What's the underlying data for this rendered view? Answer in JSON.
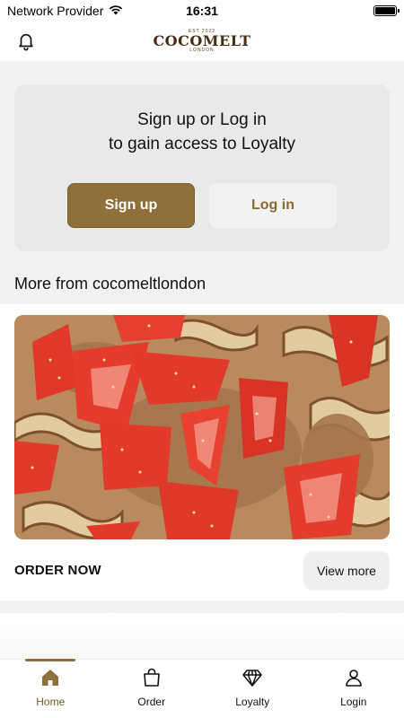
{
  "status_bar": {
    "carrier": "Network Provider",
    "time": "16:31"
  },
  "header": {
    "logo": {
      "est": "EST 2022",
      "name": "COCOMELT",
      "city": "LONDON"
    },
    "bell_icon": "bell-icon"
  },
  "login_card": {
    "line1": "Sign up or Log in",
    "line2": "to gain access to Loyalty",
    "signup_label": "Sign up",
    "login_label": "Log in"
  },
  "feed": {
    "section_title": "More from cocomeltlondon",
    "post": {
      "image_desc": "strawberries-on-chocolate-crepes",
      "cta_label": "ORDER NOW",
      "view_more_label": "View more"
    }
  },
  "tabs": [
    {
      "label": "Home",
      "icon": "home-icon",
      "active": true
    },
    {
      "label": "Order",
      "icon": "bag-icon",
      "active": false
    },
    {
      "label": "Loyalty",
      "icon": "diamond-icon",
      "active": false
    },
    {
      "label": "Login",
      "icon": "user-icon",
      "active": false
    }
  ],
  "colors": {
    "accent": "#8f6f3a",
    "accent_text": "#7a5a22",
    "card_bg": "#e9e9e9",
    "page_bg": "#f2f2f2"
  }
}
